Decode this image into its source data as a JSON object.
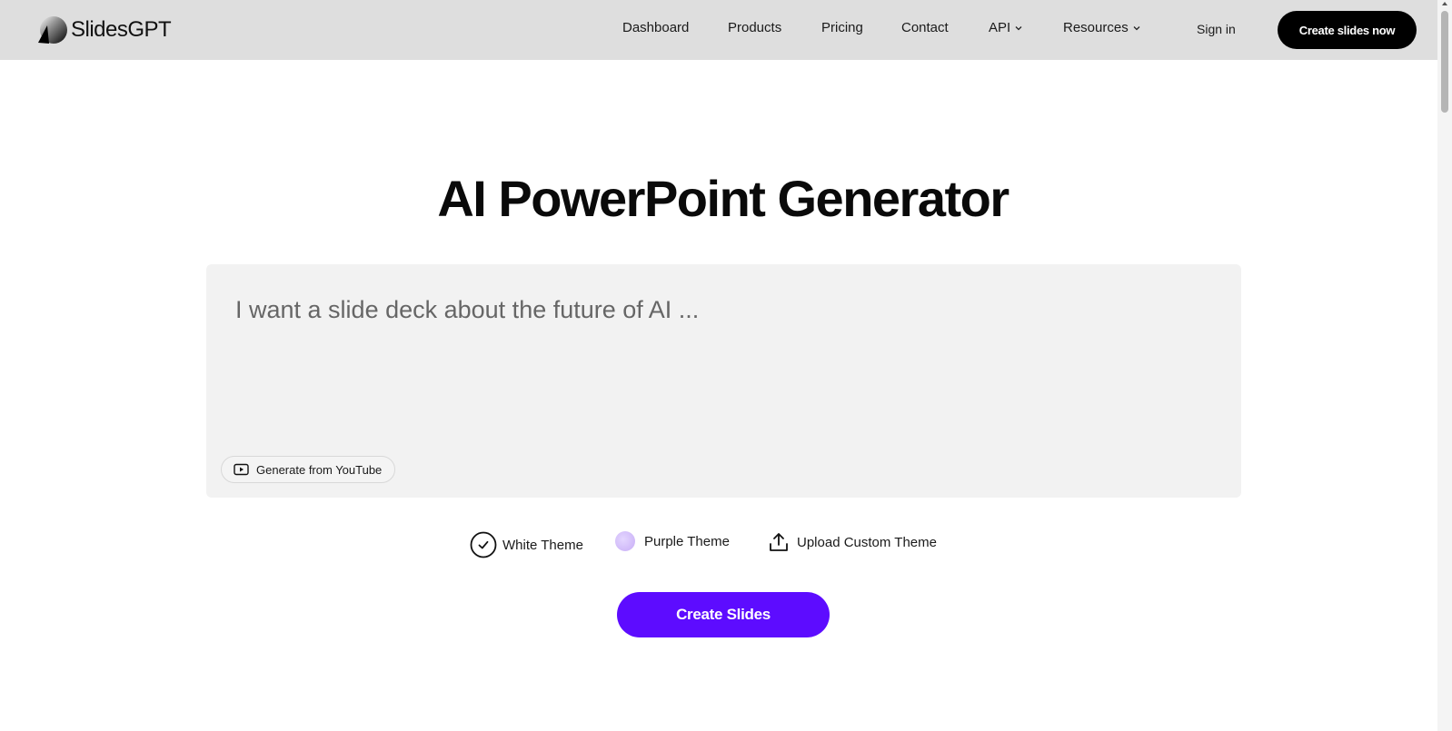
{
  "brand": {
    "name": "SlidesGPT"
  },
  "nav": {
    "items": [
      {
        "label": "Dashboard"
      },
      {
        "label": "Products"
      },
      {
        "label": "Pricing"
      },
      {
        "label": "Contact"
      },
      {
        "label": "API"
      },
      {
        "label": "Resources"
      }
    ],
    "sign_in": "Sign in",
    "cta": "Create slides now"
  },
  "hero": {
    "title": "AI PowerPoint Generator",
    "prompt_placeholder": "I want a slide deck about the future of AI ...",
    "prompt_value": "",
    "youtube_button": "Generate from YouTube"
  },
  "themes": {
    "white": "White Theme",
    "purple": "Purple Theme",
    "upload": "Upload Custom Theme",
    "selected": "white"
  },
  "actions": {
    "create": "Create Slides"
  },
  "colors": {
    "header_bg": "#dedede",
    "accent": "#5d0cff",
    "purple_swatch": "#d5c0fb"
  }
}
